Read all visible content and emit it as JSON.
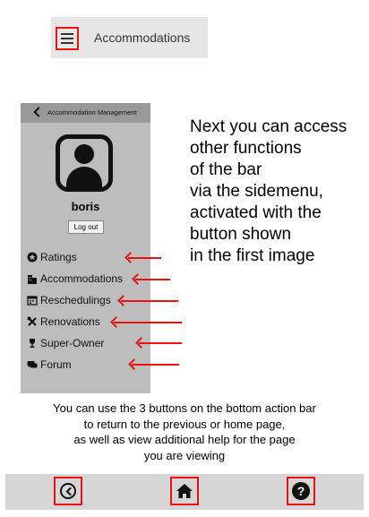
{
  "top_bar": {
    "title": "Accommodations",
    "menu_icon": "hamburger-menu-icon"
  },
  "phone": {
    "header_title": "Accommodation Management",
    "username": "boris",
    "logout_label": "Log out",
    "menu": [
      {
        "label": "Ratings",
        "icon": "star-circle-icon"
      },
      {
        "label": "Accommodations",
        "icon": "buildings-icon"
      },
      {
        "label": "Reschedulings",
        "icon": "calendar-icon"
      },
      {
        "label": "Renovations",
        "icon": "tools-icon"
      },
      {
        "label": "Super-Owner",
        "icon": "trophy-icon"
      },
      {
        "label": "Forum",
        "icon": "chat-icon"
      }
    ]
  },
  "side_text": {
    "lines": [
      "Next you can access",
      "other functions",
      "of the bar",
      "via the sidemenu,",
      "activated with the",
      "button shown",
      "in the first image"
    ]
  },
  "bottom_text": {
    "lines": [
      "You can use the 3 buttons on the bottom action bar",
      "to return to the previous or home page,",
      "as well as view additional help for the page",
      "you are viewing"
    ]
  },
  "action_bar": {
    "back_icon": "back-circle-icon",
    "home_icon": "home-icon",
    "help_icon": "help-icon",
    "help_glyph": "?"
  },
  "colors": {
    "highlight": "#ee1111",
    "panel": "#bdbdbd",
    "header": "#999999",
    "action_bar": "#d6d6d6"
  }
}
